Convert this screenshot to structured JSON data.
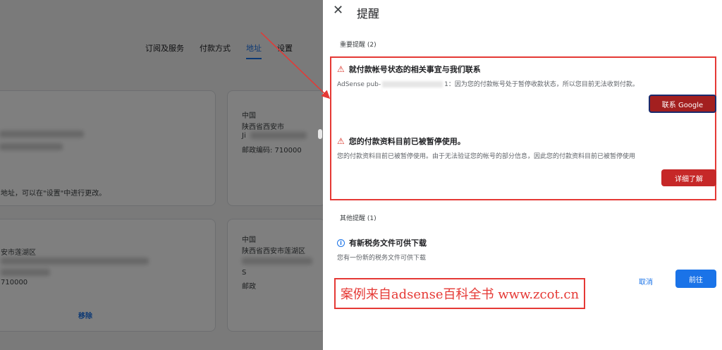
{
  "background": {
    "tabs": [
      "订阅及服务",
      "付款方式",
      "地址",
      "设置"
    ],
    "active_tab": "地址",
    "card1": {
      "note": "地址，可以在\"设置\"中进行更改。"
    },
    "card2": {
      "country": "中国",
      "region": "陕西省西安市",
      "line": "Ji",
      "postal": "邮政编码: 710000"
    },
    "card3": {
      "district": "安市莲湖区",
      "postal": "710000",
      "remove_label": "移除"
    },
    "card4": {
      "country": "中国",
      "region": "陕西省西安市莲湖区",
      "line": "S",
      "postal": "邮政"
    }
  },
  "dialog": {
    "close_glyph": "✕",
    "title": "提醒",
    "important_section": "重要提醒 (2)",
    "alerts": [
      {
        "title": "就付款帐号状态的相关事宜与我们联系",
        "desc_prefix": "AdSense pub-",
        "desc_suffix": "1：因为您的付款帐号处于暂停收款状态，所以您目前无法收到付款。",
        "button": "联系 Google"
      },
      {
        "title": "您的付款资料目前已被暂停使用。",
        "desc": "您的付款资料目前已被暂停使用。由于无法验证您的帐号的部分信息，因此您的付款资料目前已被暂停使用",
        "button": "详细了解"
      }
    ],
    "other_section": "其他提醒 (1)",
    "other_alert": {
      "title": "有新税务文件可供下载",
      "desc": "您有一份新的税务文件可供下载"
    },
    "cancel_label": "取消",
    "go_label": "前往"
  },
  "watermark": "案例来自adsense百科全书 www.zcot.cn",
  "colors": {
    "accent": "#1a73e8",
    "alert_red": "#d93025",
    "annotation_red": "#e53935"
  }
}
